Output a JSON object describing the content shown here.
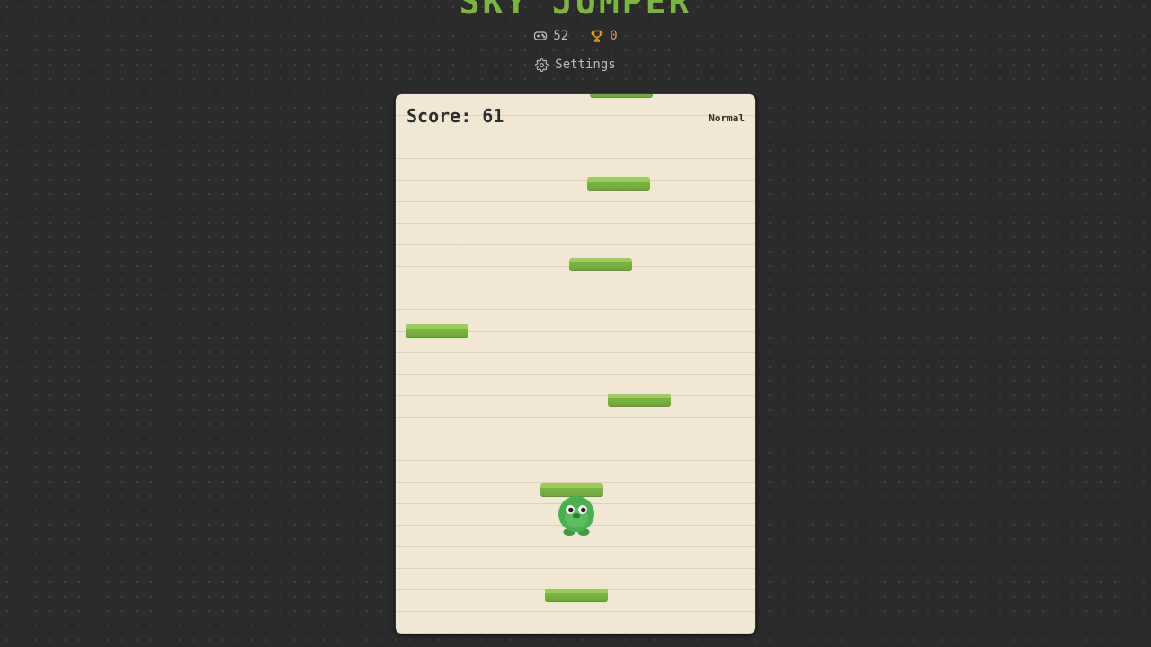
{
  "app": {
    "title": "SKY JUMPER"
  },
  "stats": {
    "games_played": "52",
    "best_score": "0"
  },
  "settings": {
    "label": "Settings"
  },
  "hud": {
    "score_label": "Score:",
    "score_value": "61",
    "difficulty": "Normal"
  },
  "icons": {
    "games": "gamepad-icon",
    "best": "trophy-icon",
    "settings": "gear-icon"
  },
  "colors": {
    "background": "#2b2b2b",
    "title": "#7cb342",
    "text_muted": "#bdbdbd",
    "trophy": "#e0a526",
    "board_bg": "#f0e8d4",
    "platform": "#7cb342",
    "player": "#4caf50"
  }
}
